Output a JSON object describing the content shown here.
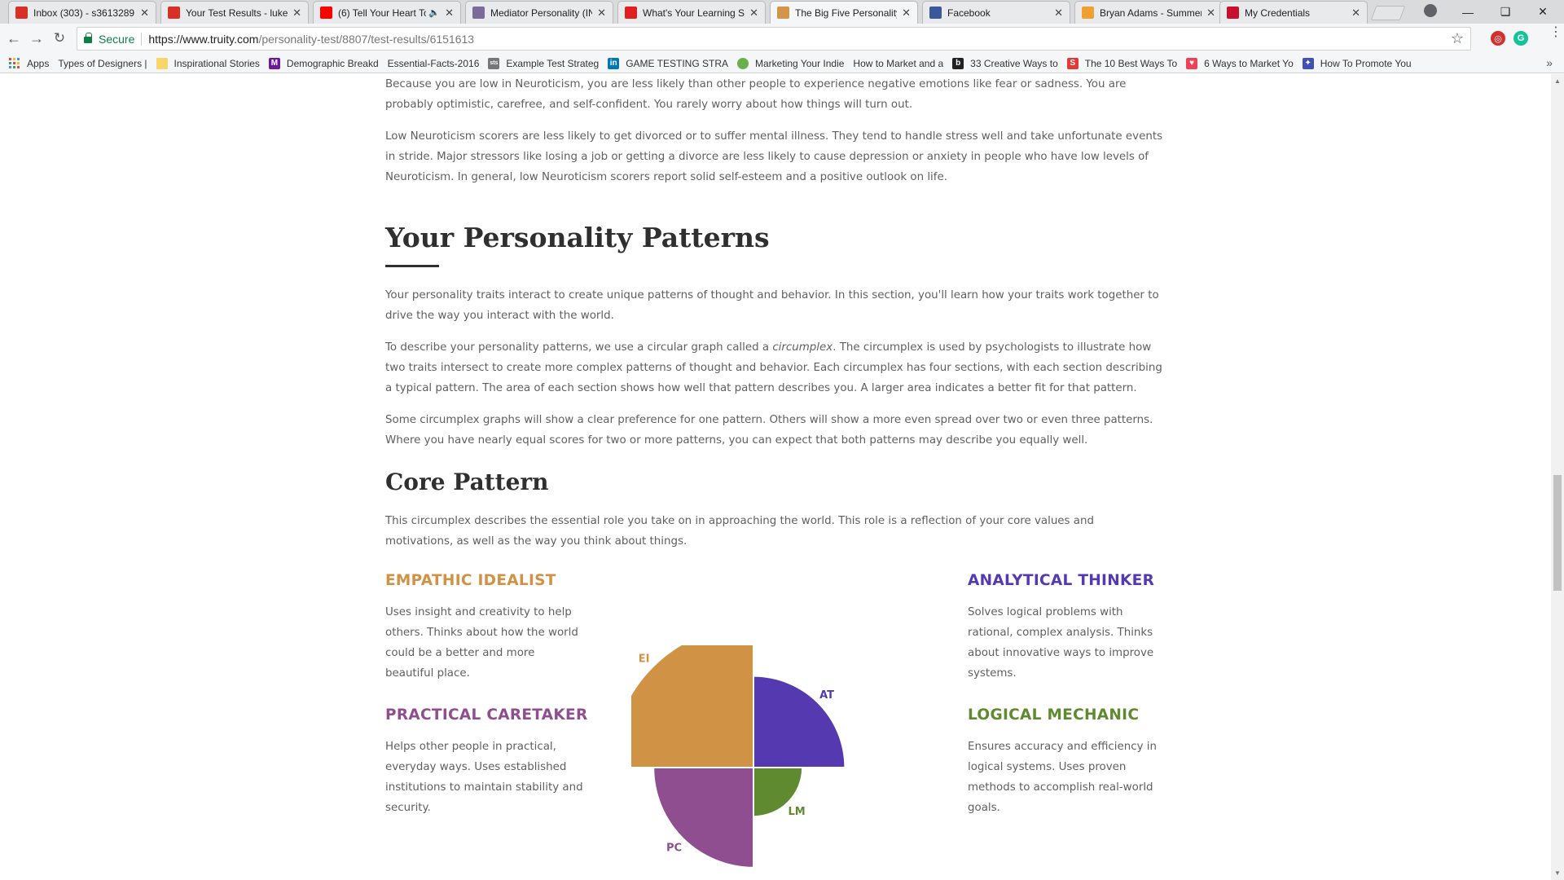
{
  "browser": {
    "tabs": [
      {
        "title": "Inbox (303) - s3613289",
        "favicon": "gmail-icon",
        "color": "#d93025",
        "active": false
      },
      {
        "title": "Your Test Results - lukef",
        "favicon": "gmail-icon",
        "color": "#d93025",
        "active": false
      },
      {
        "title": "(6) Tell Your Heart To",
        "favicon": "youtube-icon",
        "color": "#ff0000",
        "active": false,
        "muted": true
      },
      {
        "title": "Mediator Personality (IN",
        "favicon": "16p-icon",
        "color": "#7a6b9a",
        "active": false
      },
      {
        "title": "What's Your Learning St",
        "favicon": "opera-icon",
        "color": "#e02020",
        "active": false
      },
      {
        "title": "The Big Five Personality",
        "favicon": "truity-icon",
        "color": "#d4944a",
        "active": true
      },
      {
        "title": "Facebook",
        "favicon": "facebook-icon",
        "color": "#3b5998",
        "active": false
      },
      {
        "title": "Bryan Adams - Summer",
        "favicon": "lastfm-icon",
        "color": "#f0a030",
        "active": false
      },
      {
        "title": "My Credentials",
        "favicon": "credentials-icon",
        "color": "#c8102e",
        "active": false
      }
    ],
    "address": {
      "secure_label": "Secure",
      "url_host": "https://www.truity.com",
      "url_path": "/personality-test/8807/test-results/6151613"
    },
    "bookmarks": [
      {
        "label": "Apps",
        "icon": "apps-icon"
      },
      {
        "label": "Types of Designers |",
        "icon": "page-icon"
      },
      {
        "label": "Inspirational Stories",
        "icon": "folder-icon"
      },
      {
        "label": "Demographic Breakd",
        "icon": "m-icon"
      },
      {
        "label": "Essential-Facts-2016",
        "icon": "page-icon"
      },
      {
        "label": "Example Test Strateg",
        "icon": "sts-icon"
      },
      {
        "label": "GAME TESTING STRA",
        "icon": "linkedin-icon"
      },
      {
        "label": "Marketing Your Indie",
        "icon": "leaf-icon"
      },
      {
        "label": "How to Market and a",
        "icon": "page-icon"
      },
      {
        "label": "33 Creative Ways to",
        "icon": "b-icon"
      },
      {
        "label": "The 10 Best Ways To",
        "icon": "s-icon"
      },
      {
        "label": "6 Ways to Market Yo",
        "icon": "pocket-icon"
      },
      {
        "label": "How To Promote You",
        "icon": "puzzle-icon"
      }
    ]
  },
  "article": {
    "para_neuro_1": "Because you are low in Neuroticism, you are less likely than other people to experience negative emotions like fear or sadness. You are probably optimistic, carefree, and self-confident. You rarely worry about how things will turn out.",
    "para_neuro_2": "Low Neuroticism scorers are less likely to get divorced or to suffer mental illness. They tend to handle stress well and take unfortunate events in stride. Major stressors like losing a job or getting a divorce are less likely to cause depression or anxiety in people who have low levels of Neuroticism. In general, low Neuroticism scorers report solid self-esteem and a positive outlook on life.",
    "patterns_heading": "Your Personality Patterns",
    "para_patterns_1": "Your personality traits interact to create unique patterns of thought and behavior. In this section, you'll learn how your traits work together to drive the way you interact with the world.",
    "para_patterns_2a": "To describe your personality patterns, we use a circular graph called a ",
    "para_patterns_2_em": "circumplex",
    "para_patterns_2b": ". The circumplex is used by psychologists to illustrate how two traits intersect to create more complex patterns of thought and behavior. Each circumplex has four sections, with each section describing a typical pattern. The area of each section shows how well that pattern describes you. A larger area indicates a better fit for that pattern.",
    "para_patterns_3": "Some circumplex graphs will show a clear preference for one pattern. Others will show a more even spread over two or even three patterns. Where you have nearly equal scores for two or more patterns, you can expect that both patterns may describe you equally well.",
    "core_heading": "Core Pattern",
    "para_core": "This circumplex describes the essential role you take on in approaching the world. This role is a reflection of your core values and motivations, as well as the way you think about things."
  },
  "patterns": {
    "ei": {
      "title": "EMPATHIC IDEALIST",
      "desc": "Uses insight and creativity to help others. Thinks about how the world could be a better and more beautiful place.",
      "abbr": "EI",
      "color": "#d09244"
    },
    "at": {
      "title": "ANALYTICAL THINKER",
      "desc": "Solves logical problems with rational, complex analysis. Thinks about innovative ways to improve systems.",
      "abbr": "AT",
      "color": "#5539b0"
    },
    "pc": {
      "title": "PRACTICAL CARETAKER",
      "desc": "Helps other people in practical, everyday ways. Uses established institutions to maintain stability and security.",
      "abbr": "PC",
      "color": "#8f4e8f"
    },
    "lm": {
      "title": "LOGICAL MECHANIC",
      "desc": "Ensures accuracy and efficiency in logical systems. Uses proven methods to accomplish real-world goals.",
      "abbr": "LM",
      "color": "#608a30"
    }
  },
  "circumplex_fit": {
    "EI": 1.0,
    "AT": 0.64,
    "PC": 0.7,
    "LM": 0.34
  }
}
